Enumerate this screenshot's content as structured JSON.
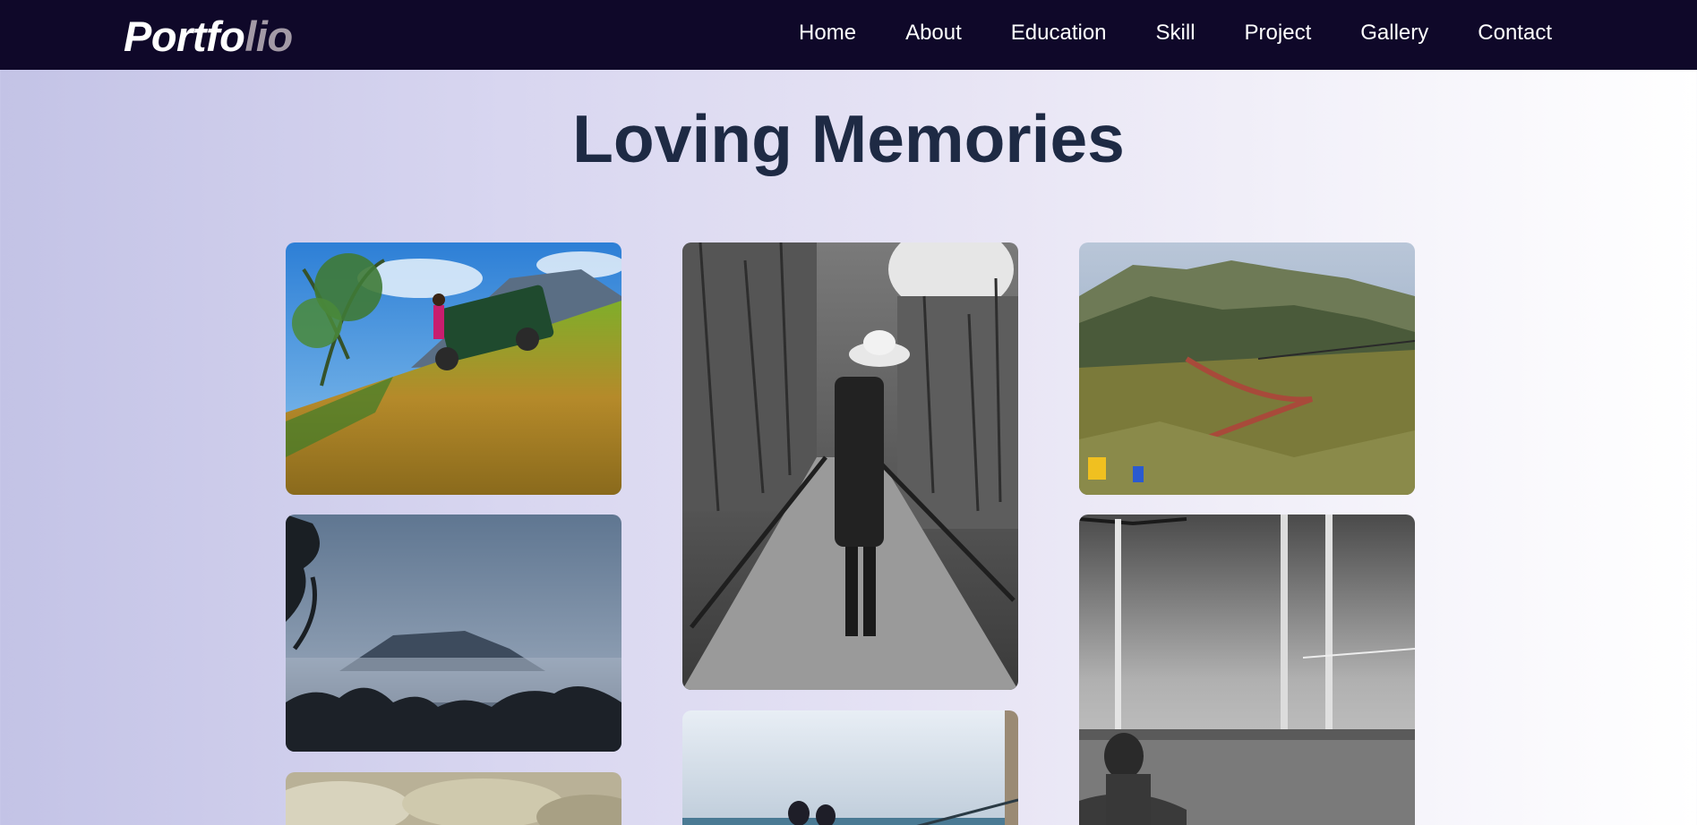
{
  "brand": {
    "logo_part1": "Portfo",
    "logo_part2": "lio",
    "colors": {
      "navbar_bg": "#0f0829",
      "logo_highlight": "#ffffff",
      "logo_muted": "#a39aa6",
      "title_color": "#1e2a44"
    }
  },
  "nav": {
    "items": [
      {
        "label": "Home"
      },
      {
        "label": "About"
      },
      {
        "label": "Education"
      },
      {
        "label": "Skill"
      },
      {
        "label": "Project"
      },
      {
        "label": "Gallery"
      },
      {
        "label": "Contact"
      }
    ]
  },
  "main": {
    "title": "Loving Memories"
  },
  "gallery": {
    "photos": [
      {
        "name": "jeep-on-hillside"
      },
      {
        "name": "misty-mountain-silhouette"
      },
      {
        "name": "cloudy-sky-partial"
      },
      {
        "name": "woman-walking-forest-path-bw"
      },
      {
        "name": "people-by-sea-partial"
      },
      {
        "name": "mountain-valley-view"
      },
      {
        "name": "woman-by-swing-poles-bw"
      }
    ]
  }
}
